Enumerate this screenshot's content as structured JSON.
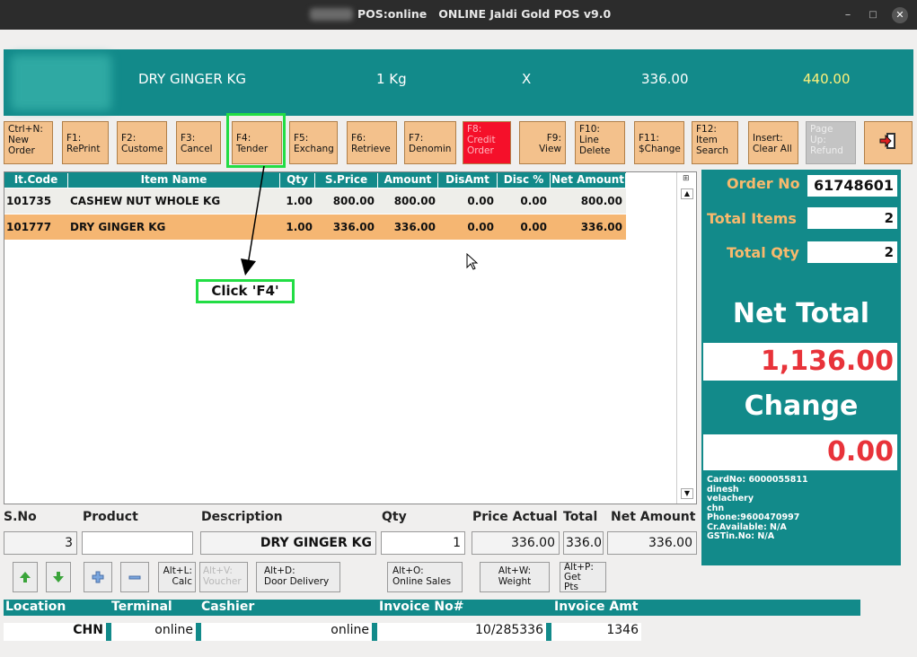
{
  "window": {
    "title": "POS:online   ONLINE Jaldi Gold POS v9.0"
  },
  "item_bar": {
    "name": "DRY GINGER KG",
    "unit": "1 Kg",
    "x": "X",
    "price": "336.00",
    "mrp": "440.00"
  },
  "fkeys": [
    {
      "l1": "Ctrl+N:",
      "l2": "New",
      "l3": "Order"
    },
    {
      "l1": "F1:",
      "l2": "RePrint"
    },
    {
      "l1": "F2:",
      "l2": "Custome"
    },
    {
      "l1": "F3:",
      "l2": "Cancel"
    },
    {
      "l1": "F4:",
      "l2": "Tender"
    },
    {
      "l1": "F5:",
      "l2": "Exchang"
    },
    {
      "l1": "F6:",
      "l2": "Retrieve"
    },
    {
      "l1": "F7:",
      "l2": "Denomin"
    },
    {
      "l1": "F8:",
      "l2": "Credit",
      "l3": "Order"
    },
    {
      "l1": "F9:",
      "l2": "View"
    },
    {
      "l1": "F10:",
      "l2": "Line",
      "l3": "Delete"
    },
    {
      "l1": "F11:",
      "l2": "$Change"
    },
    {
      "l1": "F12:",
      "l2": "Item",
      "l3": "Search"
    },
    {
      "l1": "Insert:",
      "l2": "Clear All"
    },
    {
      "l1": "Page",
      "l2": "Up:",
      "l3": "Refund"
    }
  ],
  "table": {
    "columns": [
      "It.Code",
      "Item Name",
      "Qty",
      "S.Price",
      "Amount",
      "DisAmt",
      "Disc %",
      "Net Amount"
    ],
    "rows": [
      [
        "101735",
        "CASHEW NUT WHOLE KG",
        "1.00",
        "800.00",
        "800.00",
        "0.00",
        "0.00",
        "800.00"
      ],
      [
        "101777",
        "DRY GINGER KG",
        "1.00",
        "336.00",
        "336.00",
        "0.00",
        "0.00",
        "336.00"
      ]
    ]
  },
  "annotation": {
    "text": "Click 'F4'"
  },
  "summary": {
    "order_no_label": "Order No",
    "order_no": "61748601",
    "total_items_label": "Total Items",
    "total_items": "2",
    "total_qty_label": "Total Qty",
    "total_qty": "2",
    "net_total_label": "Net Total",
    "net_total": "1,136.00",
    "change_label": "Change",
    "change": "0.00",
    "customer": [
      "CardNo: 6000055811",
      "dinesh",
      "velachery",
      "chn",
      "Phone:9600470997",
      "Cr.Available: N/A",
      "GSTin.No: N/A"
    ]
  },
  "entry": {
    "labels": {
      "sno": "S.No",
      "product": "Product",
      "description": "Description",
      "qty": "Qty",
      "price_actual": "Price Actual",
      "total": "Total",
      "net_amount": "Net Amount"
    },
    "sno": "3",
    "product": "",
    "description": "DRY GINGER KG",
    "qty": "1",
    "price_actual": "336.00",
    "total": "336.0",
    "net_amount": "336.00"
  },
  "shortcuts": {
    "calc": {
      "l1": "Alt+L:",
      "l2": "Calc"
    },
    "voucher": {
      "l1": "Alt+V:",
      "l2": "Voucher"
    },
    "door": {
      "l1": "Alt+D:",
      "l2": "Door Delivery"
    },
    "online": {
      "l1": "Alt+O:",
      "l2": "Online Sales"
    },
    "weight": {
      "l1": "Alt+W:",
      "l2": "Weight"
    },
    "points": {
      "l1": "Alt+P:",
      "l2": "Get",
      "l3": "Pts"
    }
  },
  "footer": {
    "labels": {
      "location": "Location",
      "terminal": "Terminal",
      "cashier": "Cashier",
      "invoice_no": "Invoice No#",
      "invoice_amt": "Invoice Amt"
    },
    "location": "CHN",
    "terminal": "online",
    "cashier": "online",
    "invoice_no": "10/285336",
    "invoice_amt": "1346"
  },
  "colors": {
    "teal": "#128a8a",
    "orange_label": "#f7b96d",
    "net_red": "#e8333a",
    "selected_row": "#f5b672",
    "fkey": "#f3c18c",
    "highlight_green": "#22dd44"
  }
}
